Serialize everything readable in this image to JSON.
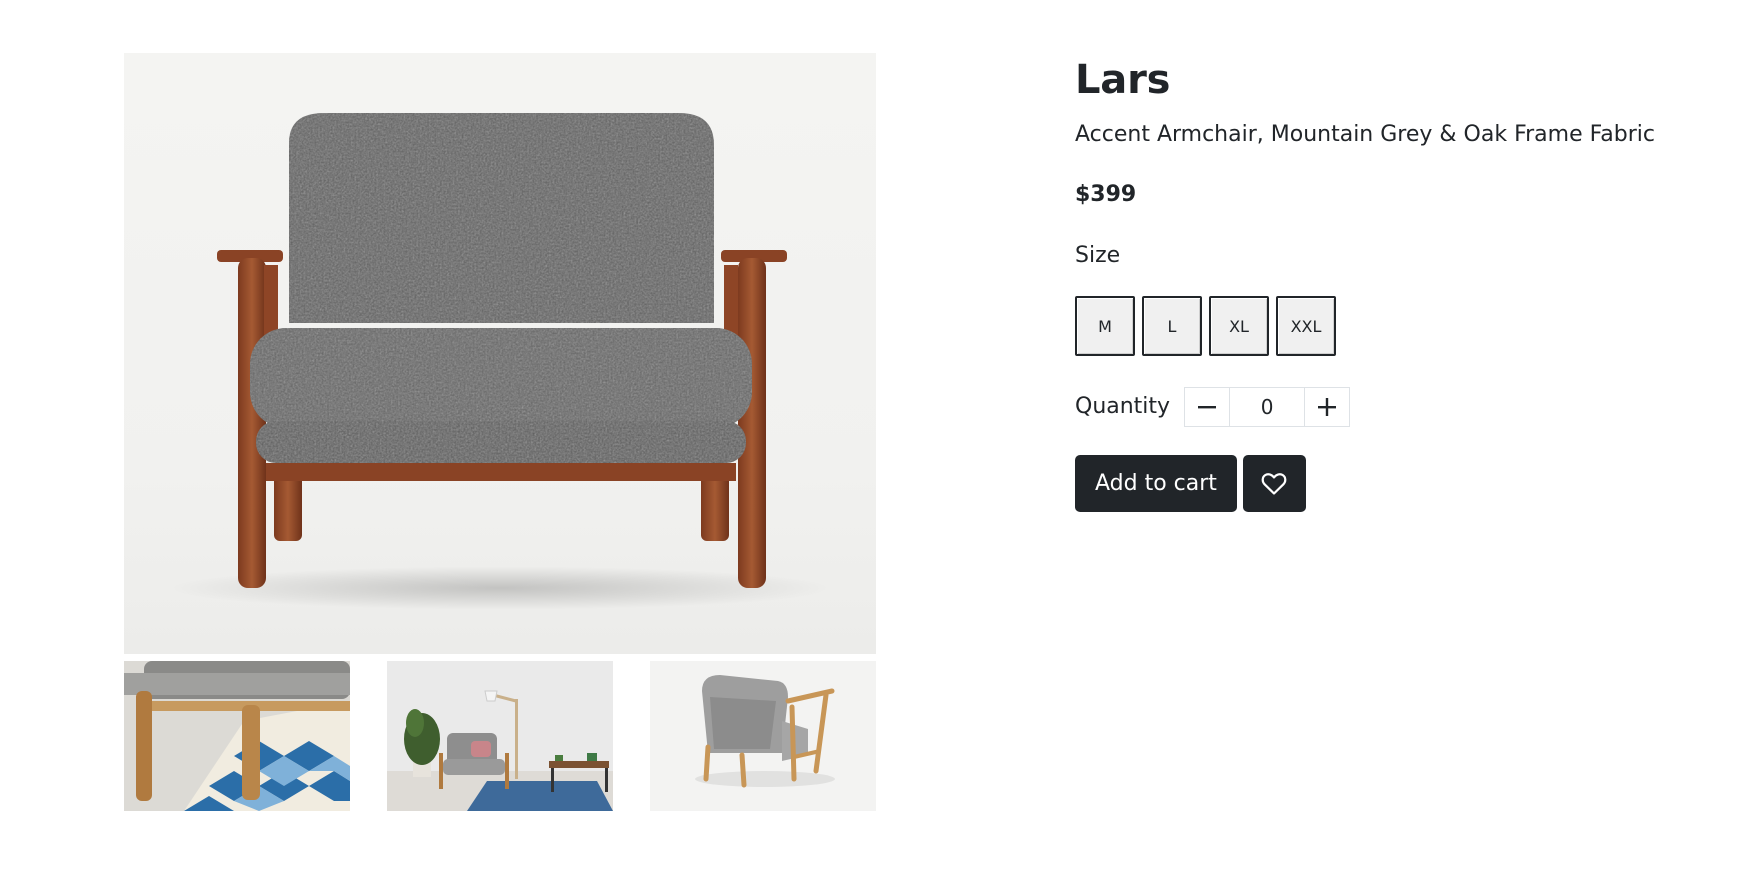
{
  "product": {
    "name": "Lars",
    "subtitle": "Accent Armchair, Mountain Grey & Oak Frame Fabric",
    "price": "$399"
  },
  "images": {
    "main": "product-main-image",
    "thumbnails": [
      "thumbnail-leg-closeup",
      "thumbnail-room-scene",
      "thumbnail-back-view"
    ]
  },
  "size": {
    "label": "Size",
    "options": [
      "M",
      "L",
      "XL",
      "XXL"
    ]
  },
  "quantity": {
    "label": "Quantity",
    "value": "0",
    "decrement_icon": "minus-icon",
    "increment_icon": "plus-icon"
  },
  "actions": {
    "add_to_cart_label": "Add to cart",
    "wishlist_icon": "heart-icon"
  },
  "colors": {
    "primary_dark": "#212529",
    "border": "#dee2e6",
    "size_option_bg": "#f0f0f0"
  }
}
